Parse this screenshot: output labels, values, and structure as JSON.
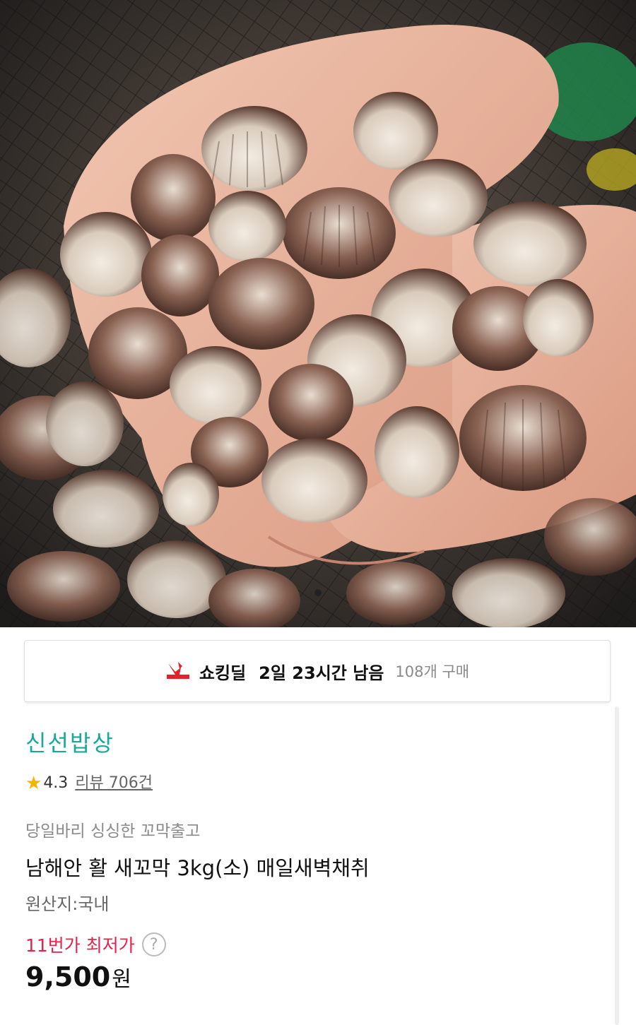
{
  "hero": {
    "image_description_icon": "cockle-clams-photo-icon",
    "pager": {
      "current": 1,
      "total": 1
    }
  },
  "deal": {
    "logo_icon": "shocking-deal-logo-icon",
    "label": "쇼킹딜",
    "time_left": "2일 23시간 남음",
    "purchase_count": "108개 구매",
    "accent_color": "#e4202c"
  },
  "product": {
    "seller": "신선밥상",
    "rating": "4.3",
    "review_text": "리뷰 706건",
    "tagline": "당일바리 싱싱한 꼬막출고",
    "name": "남해안 활 새꼬막 3kg(소) 매일새벽채취",
    "origin": "원산지:국내",
    "price_label": "11번가 최저가",
    "help_symbol": "?",
    "price": "9,500",
    "currency": "원"
  },
  "colors": {
    "seller": "#1aa89a",
    "price_label": "#e8204a",
    "star": "#f5b400"
  }
}
